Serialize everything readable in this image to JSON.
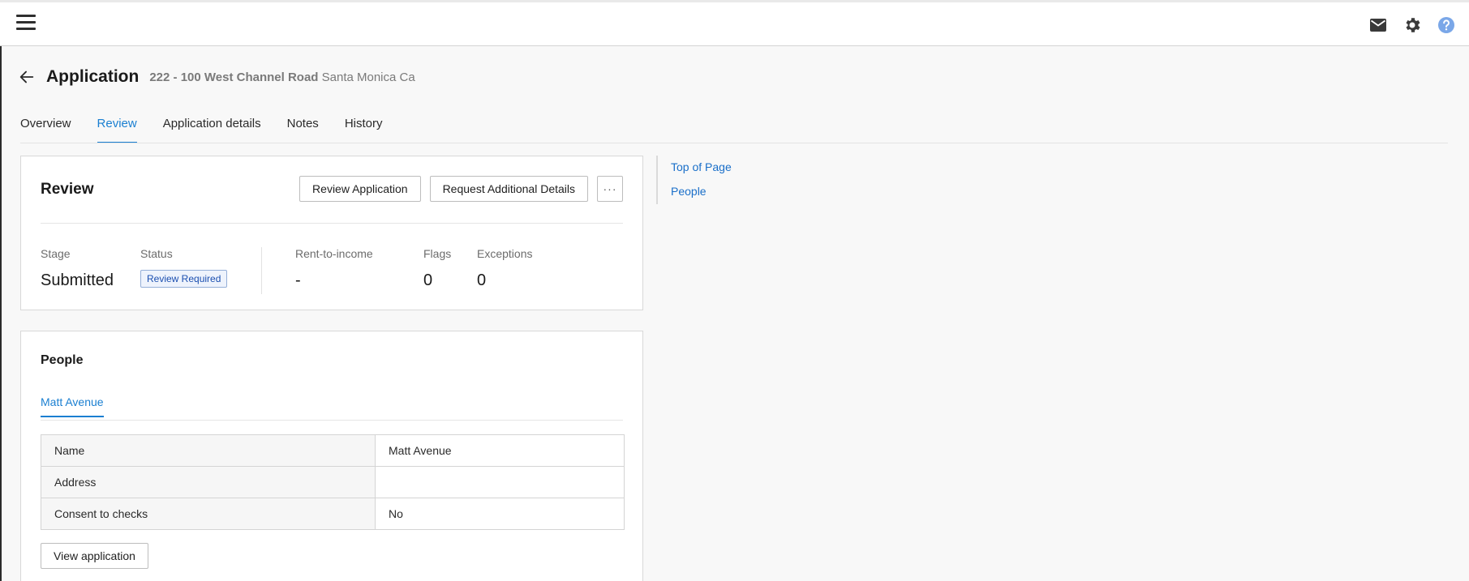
{
  "header": {
    "icons": [
      "menu-icon",
      "mail-icon",
      "gear-icon",
      "help-icon"
    ],
    "help_color": "#7aa7e8"
  },
  "page": {
    "title": "Application",
    "address_unit": "222 - 100 West Channel Road",
    "address_city": "Santa Monica Ca"
  },
  "tabs": [
    {
      "label": "Overview"
    },
    {
      "label": "Review",
      "active": true
    },
    {
      "label": "Application details"
    },
    {
      "label": "Notes"
    },
    {
      "label": "History"
    }
  ],
  "review": {
    "title": "Review",
    "review_button": "Review Application",
    "request_button": "Request Additional Details",
    "more_button": "···",
    "stage_label": "Stage",
    "stage_value": "Submitted",
    "status_label": "Status",
    "status_value": "Review Required",
    "rti_label": "Rent-to-income",
    "rti_value": "-",
    "flags_label": "Flags",
    "flags_value": "0",
    "exceptions_label": "Exceptions",
    "exceptions_value": "0"
  },
  "people": {
    "title": "People",
    "tab": "Matt Avenue",
    "rows": [
      {
        "key": "Name",
        "value": "Matt Avenue"
      },
      {
        "key": "Address",
        "value": ""
      },
      {
        "key": "Consent to checks",
        "value": "No"
      }
    ],
    "view_button": "View application"
  },
  "jumpnav": {
    "items": [
      "Top of Page",
      "People"
    ]
  },
  "colors": {
    "accent": "#1a7fd1",
    "link": "#1a6fc9",
    "badge_text": "#1b4fb0"
  }
}
